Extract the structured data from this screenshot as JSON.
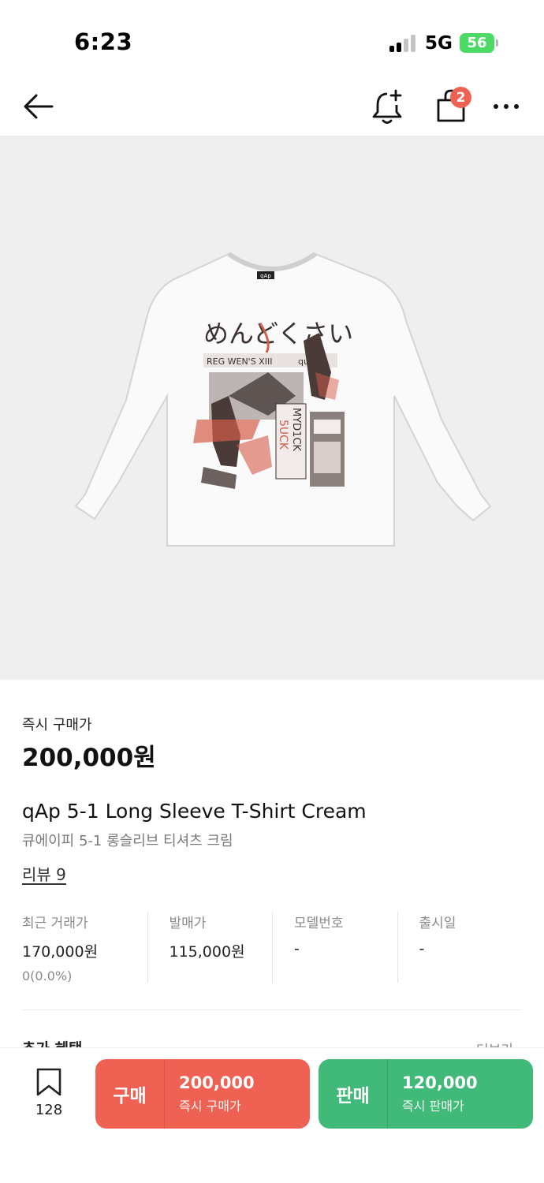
{
  "status_bar": {
    "time": "6:23",
    "network": "5G",
    "battery": "56"
  },
  "nav": {
    "cart_badge": "2"
  },
  "product": {
    "instant_buy_label": "즉시 구매가",
    "price": "200,000원",
    "name_en": "qAp 5-1 Long Sleeve T-Shirt Cream",
    "name_ko": "큐에이피 5-1 롱슬리브 티셔츠 크림",
    "review_link": "리뷰 9"
  },
  "shirt_print": {
    "brand_tag": "qAp",
    "headline": "めんどくさい",
    "banner_text": "REG WEN'S XIII",
    "side_text": "qualia",
    "column_a": "5UCK",
    "column_b": "MYD1CK"
  },
  "stats": [
    {
      "label": "최근 거래가",
      "value": "170,000원",
      "sub": "0(0.0%)"
    },
    {
      "label": "발매가",
      "value": "115,000원",
      "sub": ""
    },
    {
      "label": "모델번호",
      "value": "-",
      "sub": ""
    },
    {
      "label": "출시일",
      "value": "-",
      "sub": ""
    }
  ],
  "benefits": {
    "title": "추가 혜택",
    "more": "더보기"
  },
  "bottom_bar": {
    "wish_count": "128",
    "buy": {
      "label": "구매",
      "price": "200,000",
      "sub": "즉시 구매가"
    },
    "sell": {
      "label": "판매",
      "price": "120,000",
      "sub": "즉시 판매가"
    }
  },
  "colors": {
    "buy": "#ef6253",
    "sell": "#41b979",
    "badge": "#ef6253",
    "battery": "#4cd964"
  }
}
